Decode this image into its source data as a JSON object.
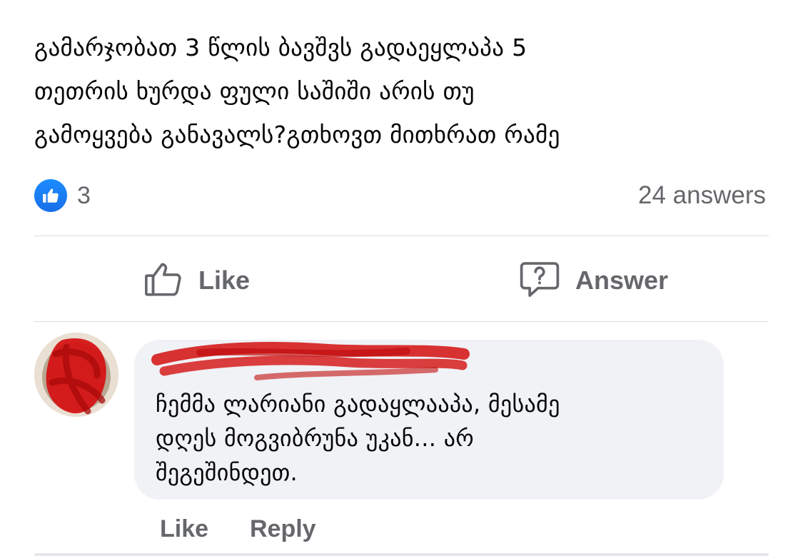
{
  "post": {
    "text": "გამარჯობათ 3 წლის ბავშვს გადაეყლაპა 5\nთეთრის ხურდა ფული საშიში არის თუ\nგამოყვება განავალს?გთხოვთ მითხრათ რამე"
  },
  "reactions": {
    "icon": "like-thumb-icon",
    "count": "3",
    "accent": "#1877f2"
  },
  "answers_count": "24 answers",
  "actions": {
    "like_label": "Like",
    "answer_label": "Answer"
  },
  "comment": {
    "author": "",
    "text": "ჩემმა ლარიანი გადაყლააპა, მესამე\nდღეს მოგვიბრუნა უკან... არ\nშეგეშინდეთ.",
    "like_label": "Like",
    "reply_label": "Reply"
  },
  "colors": {
    "secondary_text": "#65676b",
    "bubble_bg": "#f0f2f5",
    "redaction": "#d40f0f"
  }
}
